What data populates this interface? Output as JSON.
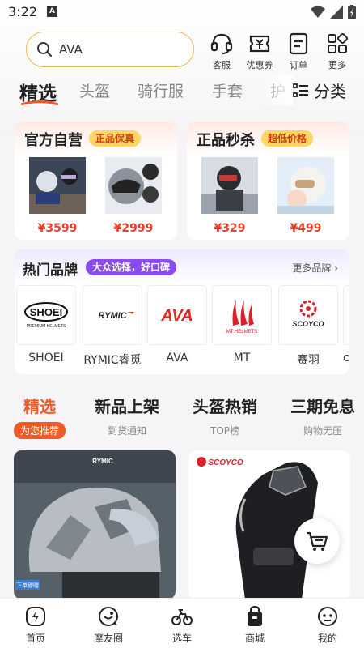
{
  "status_bar": {
    "time": "3:22",
    "notification_letter": "A"
  },
  "search": {
    "value": "AVA"
  },
  "quick_actions": [
    {
      "label": "客服",
      "icon": "headset-icon"
    },
    {
      "label": "优惠券",
      "icon": "coupon-icon"
    },
    {
      "label": "订单",
      "icon": "order-icon"
    },
    {
      "label": "更多",
      "icon": "grid-icon"
    }
  ],
  "categories": [
    "精选",
    "头盔",
    "骑行服",
    "手套",
    "护"
  ],
  "classify_label": "分类",
  "promos": [
    {
      "title": "官方自营",
      "tag": "正品保真",
      "products": [
        {
          "price": "¥3599"
        },
        {
          "price": "¥2999"
        }
      ]
    },
    {
      "title": "正品秒杀",
      "tag": "超低价格",
      "products": [
        {
          "price": "¥329"
        },
        {
          "price": "¥499"
        }
      ]
    }
  ],
  "brands": {
    "title": "热门品牌",
    "tag": "大众选择，好口碑",
    "more": "更多品牌 ›",
    "items": [
      {
        "name": "SHOEI",
        "logo": "SHOEI",
        "logo_sub": "PREMIUM HELMETS"
      },
      {
        "name": "RYMIC睿觅",
        "logo": "RYMIC"
      },
      {
        "name": "AVA",
        "logo": "AVA"
      },
      {
        "name": "MT",
        "logo": "MT",
        "logo_sub": "MT HELMETS"
      },
      {
        "name": "赛羽",
        "logo": "SCOYCO"
      },
      {
        "name": "c"
      }
    ]
  },
  "feed_tabs": [
    {
      "title": "精选",
      "subtitle": "为您推荐"
    },
    {
      "title": "新品上架",
      "subtitle": "到货通知"
    },
    {
      "title": "头盔热销",
      "subtitle": "TOP榜"
    },
    {
      "title": "三期免息",
      "subtitle": "购物无压"
    }
  ],
  "feed_cards": [
    {
      "brand_text": "RYMIC",
      "badge": "下单即赠"
    },
    {
      "brand_text": "SCOYCO"
    }
  ],
  "bottom_nav": [
    {
      "label": "首页",
      "icon": "home-icon"
    },
    {
      "label": "摩友圈",
      "icon": "community-icon"
    },
    {
      "label": "选车",
      "icon": "motorcycle-icon"
    },
    {
      "label": "商城",
      "icon": "mall-bag-icon"
    },
    {
      "label": "我的",
      "icon": "profile-icon"
    }
  ],
  "colors": {
    "accent": "#f15a24",
    "search_border": "#f2b64b",
    "price": "#ec3f2b",
    "brand_tag": "#8a4cf0"
  }
}
